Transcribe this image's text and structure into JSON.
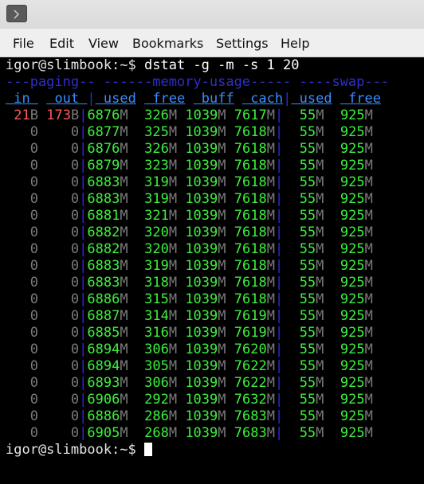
{
  "window": {
    "terminal_icon": "terminal-icon"
  },
  "menubar": {
    "items": [
      "File",
      "Edit",
      "View",
      "Bookmarks",
      "Settings",
      "Help"
    ]
  },
  "terminal": {
    "prompt": "igor@slimbook:~$",
    "command": " dstat -g -m -s 1 20",
    "group_header": "---paging-- ------memory-usage----- ----swap---",
    "column_header": {
      "in": " in ",
      "out": " out ",
      "used": " used",
      "free": " free",
      "buff": " buff",
      "cach": " cach",
      "swap_used": " used",
      "swap_free": " free"
    },
    "rows": [
      [
        "21",
        "B",
        "173",
        "B",
        "6876",
        "M",
        " 326",
        "M",
        "1039",
        "M",
        "7617",
        "M",
        "  55",
        "M",
        " 925",
        "M"
      ],
      [
        "0",
        "",
        "0",
        "",
        "6877",
        "M",
        " 325",
        "M",
        "1039",
        "M",
        "7618",
        "M",
        "  55",
        "M",
        " 925",
        "M"
      ],
      [
        "0",
        "",
        "0",
        "",
        "6876",
        "M",
        " 326",
        "M",
        "1039",
        "M",
        "7618",
        "M",
        "  55",
        "M",
        " 925",
        "M"
      ],
      [
        "0",
        "",
        "0",
        "",
        "6879",
        "M",
        " 323",
        "M",
        "1039",
        "M",
        "7618",
        "M",
        "  55",
        "M",
        " 925",
        "M"
      ],
      [
        "0",
        "",
        "0",
        "",
        "6883",
        "M",
        " 319",
        "M",
        "1039",
        "M",
        "7618",
        "M",
        "  55",
        "M",
        " 925",
        "M"
      ],
      [
        "0",
        "",
        "0",
        "",
        "6883",
        "M",
        " 319",
        "M",
        "1039",
        "M",
        "7618",
        "M",
        "  55",
        "M",
        " 925",
        "M"
      ],
      [
        "0",
        "",
        "0",
        "",
        "6881",
        "M",
        " 321",
        "M",
        "1039",
        "M",
        "7618",
        "M",
        "  55",
        "M",
        " 925",
        "M"
      ],
      [
        "0",
        "",
        "0",
        "",
        "6882",
        "M",
        " 320",
        "M",
        "1039",
        "M",
        "7618",
        "M",
        "  55",
        "M",
        " 925",
        "M"
      ],
      [
        "0",
        "",
        "0",
        "",
        "6882",
        "M",
        " 320",
        "M",
        "1039",
        "M",
        "7618",
        "M",
        "  55",
        "M",
        " 925",
        "M"
      ],
      [
        "0",
        "",
        "0",
        "",
        "6883",
        "M",
        " 319",
        "M",
        "1039",
        "M",
        "7618",
        "M",
        "  55",
        "M",
        " 925",
        "M"
      ],
      [
        "0",
        "",
        "0",
        "",
        "6883",
        "M",
        " 318",
        "M",
        "1039",
        "M",
        "7618",
        "M",
        "  55",
        "M",
        " 925",
        "M"
      ],
      [
        "0",
        "",
        "0",
        "",
        "6886",
        "M",
        " 315",
        "M",
        "1039",
        "M",
        "7618",
        "M",
        "  55",
        "M",
        " 925",
        "M"
      ],
      [
        "0",
        "",
        "0",
        "",
        "6887",
        "M",
        " 314",
        "M",
        "1039",
        "M",
        "7619",
        "M",
        "  55",
        "M",
        " 925",
        "M"
      ],
      [
        "0",
        "",
        "0",
        "",
        "6885",
        "M",
        " 316",
        "M",
        "1039",
        "M",
        "7619",
        "M",
        "  55",
        "M",
        " 925",
        "M"
      ],
      [
        "0",
        "",
        "0",
        "",
        "6894",
        "M",
        " 306",
        "M",
        "1039",
        "M",
        "7620",
        "M",
        "  55",
        "M",
        " 925",
        "M"
      ],
      [
        "0",
        "",
        "0",
        "",
        "6894",
        "M",
        " 305",
        "M",
        "1039",
        "M",
        "7622",
        "M",
        "  55",
        "M",
        " 925",
        "M"
      ],
      [
        "0",
        "",
        "0",
        "",
        "6893",
        "M",
        " 306",
        "M",
        "1039",
        "M",
        "7622",
        "M",
        "  55",
        "M",
        " 925",
        "M"
      ],
      [
        "0",
        "",
        "0",
        "",
        "6906",
        "M",
        " 292",
        "M",
        "1039",
        "M",
        "7632",
        "M",
        "  55",
        "M",
        " 925",
        "M"
      ],
      [
        "0",
        "",
        "0",
        "",
        "6886",
        "M",
        " 286",
        "M",
        "1039",
        "M",
        "7683",
        "M",
        "  55",
        "M",
        " 925",
        "M"
      ],
      [
        "0",
        "",
        "0",
        "",
        "6905",
        "M",
        " 268",
        "M",
        "1039",
        "M",
        "7683",
        "M",
        "  55",
        "M",
        " 925",
        "M"
      ]
    ],
    "final_prompt": "igor@slimbook:~$"
  }
}
